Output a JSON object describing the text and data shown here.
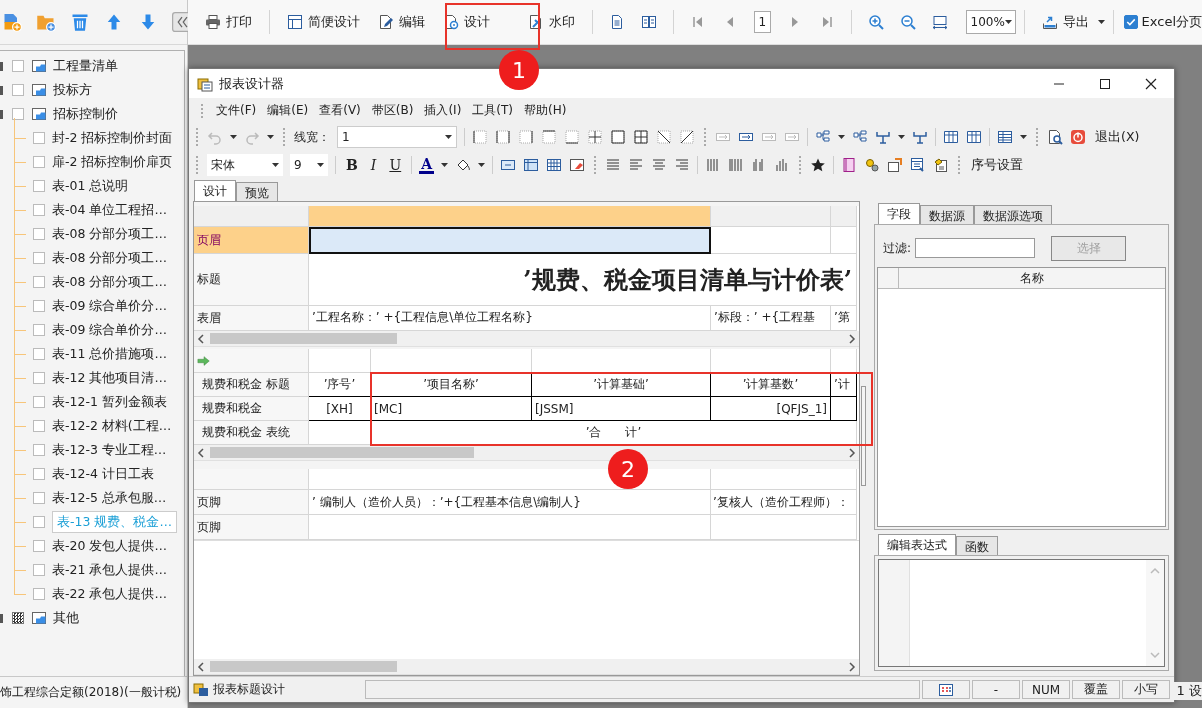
{
  "sidebar": {
    "tree": [
      {
        "label": "工程量清单",
        "checked": false,
        "selected": false
      },
      {
        "label": "投标方",
        "checked": false,
        "selected": false
      },
      {
        "label": "招标控制价",
        "checked": false,
        "selected": false,
        "children": [
          {
            "label": "封-2 招标控制价封面",
            "checked": false,
            "selected": false
          },
          {
            "label": "扉-2 招标控制价扉页",
            "checked": false,
            "selected": false
          },
          {
            "label": "表-01 总说明",
            "checked": false,
            "selected": false
          },
          {
            "label": "表-04 单位工程招…",
            "checked": false,
            "selected": false
          },
          {
            "label": "表-08 分部分项工…",
            "checked": false,
            "selected": false
          },
          {
            "label": "表-08 分部分项工…",
            "checked": false,
            "selected": false
          },
          {
            "label": "表-08 分部分项工…",
            "checked": false,
            "selected": false
          },
          {
            "label": "表-09 综合单价分…",
            "checked": false,
            "selected": false
          },
          {
            "label": "表-09 综合单价分…",
            "checked": false,
            "selected": false
          },
          {
            "label": "表-11 总价措施项…",
            "checked": false,
            "selected": false
          },
          {
            "label": "表-12 其他项目清…",
            "checked": false,
            "selected": false
          },
          {
            "label": "表-12-1 暂列金额表",
            "checked": false,
            "selected": false
          },
          {
            "label": "表-12-2 材料(工程…",
            "checked": false,
            "selected": false
          },
          {
            "label": "表-12-3 专业工程…",
            "checked": false,
            "selected": false
          },
          {
            "label": "表-12-4 计日工表",
            "checked": false,
            "selected": false
          },
          {
            "label": "表-12-5 总承包服…",
            "checked": false,
            "selected": false
          },
          {
            "label": "表-13 规费、税金…",
            "checked": false,
            "selected": true
          },
          {
            "label": "表-20 发包人提供…",
            "checked": false,
            "selected": false
          },
          {
            "label": "表-21 承包人提供…",
            "checked": false,
            "selected": false
          },
          {
            "label": "表-22 承包人提供…",
            "checked": false,
            "selected": false
          }
        ]
      },
      {
        "label": "其他",
        "indeterminate": true,
        "selected": false
      }
    ],
    "footer": "饰工程综合定额(2018)(一般计税)"
  },
  "toolbar": {
    "buttons": [
      {
        "label": "打印"
      },
      {
        "label": "简便设计"
      },
      {
        "label": "编辑"
      },
      {
        "label": "设计"
      },
      {
        "label": "水印"
      }
    ],
    "page": "1",
    "zoom": "100%",
    "export": "导出",
    "excel_paging": {
      "label": "Excel分页",
      "checked": true
    }
  },
  "designer": {
    "title": "报表设计器",
    "menu": [
      "文件(F)",
      "编辑(E)",
      "查看(V)",
      "带区(B)",
      "插入(I)",
      "工具(T)",
      "帮助(H)"
    ],
    "line_width": {
      "label": "线宽：",
      "value": "1"
    },
    "exit": "退出(X)",
    "font": "宋体",
    "font_size": "9",
    "text_format": [
      {
        "label": "B",
        "kind": "bold"
      },
      {
        "label": "I",
        "kind": "italic"
      },
      {
        "label": "U",
        "kind": "underline"
      }
    ],
    "font_color": "A",
    "serial": "序号设置",
    "tabs": [
      {
        "label": "设计",
        "selected": true
      },
      {
        "label": "预览",
        "selected": false
      }
    ],
    "grid": {
      "page_band": [
        {
          "label": "页眉",
          "selected": true
        },
        {
          "label": "标题",
          "selected": false,
          "title": "’规费、税金项目清单与计价表’"
        },
        {
          "label": "表眉",
          "selected": false,
          "cells": [
            "’工程名称：’ +{工程信息\\单位工程名称}",
            "’标段：’ +{工程基",
            "’第"
          ]
        }
      ],
      "detail_band": [
        {
          "label": "规费和税金 标题",
          "selected": false,
          "cells": [
            "’序号’",
            "’项目名称’",
            "’计算基础’",
            "’计算基数’",
            "’计"
          ]
        },
        {
          "label": "规费和税金",
          "selected": false,
          "cells": [
            "[XH]",
            "[MC]",
            "[JSSM]",
            "[QFJS_1]"
          ]
        },
        {
          "label": "规费和税金 表统",
          "selected": false,
          "total": "’合　　计’"
        }
      ],
      "footer_band": [
        {
          "label": "页脚",
          "selected": false,
          "cells": [
            "’ 编制人（造价人员）：’+{工程基本信息\\编制人}",
            "’复核人（造价工程师）："
          ]
        },
        {
          "label": "页脚",
          "selected": false
        }
      ]
    },
    "field_tabs": [
      {
        "label": "字段",
        "selected": true
      },
      {
        "label": "数据源",
        "selected": false
      },
      {
        "label": "数据源选项",
        "selected": false
      }
    ],
    "filter": {
      "label": "过滤:",
      "button": "选择",
      "button_disabled": true
    },
    "list_columns": [
      "名称"
    ],
    "expr_tabs": [
      {
        "label": "编辑表达式",
        "selected": true
      },
      {
        "label": "函数",
        "selected": false
      }
    ],
    "status_bar": {
      "text": "报表标题设计",
      "cells": [
        "-",
        "NUM",
        "覆盖",
        "小写"
      ]
    }
  },
  "background_status": "1 设",
  "annotations": [
    {
      "label": "1"
    },
    {
      "label": "2"
    }
  ]
}
